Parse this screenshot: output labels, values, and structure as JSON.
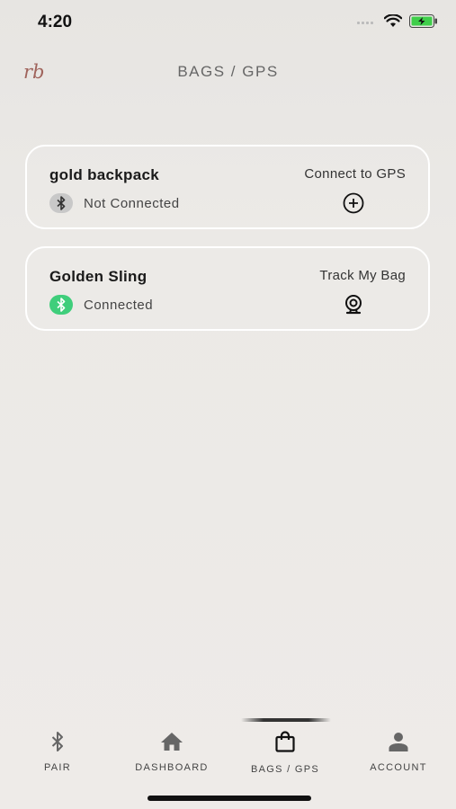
{
  "status_bar": {
    "time": "4:20",
    "battery_color": "#3fce4a"
  },
  "header": {
    "logo_text": "rb",
    "title": "BAGS / GPS"
  },
  "bags": [
    {
      "name": "gold backpack",
      "status": "Not Connected",
      "connected": false,
      "action_label": "Connect to GPS",
      "action_icon": "plus-circle-icon"
    },
    {
      "name": "Golden Sling",
      "status": "Connected",
      "connected": true,
      "action_label": "Track My Bag",
      "action_icon": "webcam-icon"
    }
  ],
  "tabs": [
    {
      "label": "PAIR",
      "icon": "bluetooth-icon"
    },
    {
      "label": "DASHBOARD",
      "icon": "home-icon"
    },
    {
      "label": "BAGS / GPS",
      "icon": "shopping-bag-icon",
      "active": true
    },
    {
      "label": "ACCOUNT",
      "icon": "person-icon"
    }
  ],
  "colors": {
    "connected": "#3fce7b",
    "not_connected": "#c8c8c8",
    "logo": "#a0645c"
  }
}
